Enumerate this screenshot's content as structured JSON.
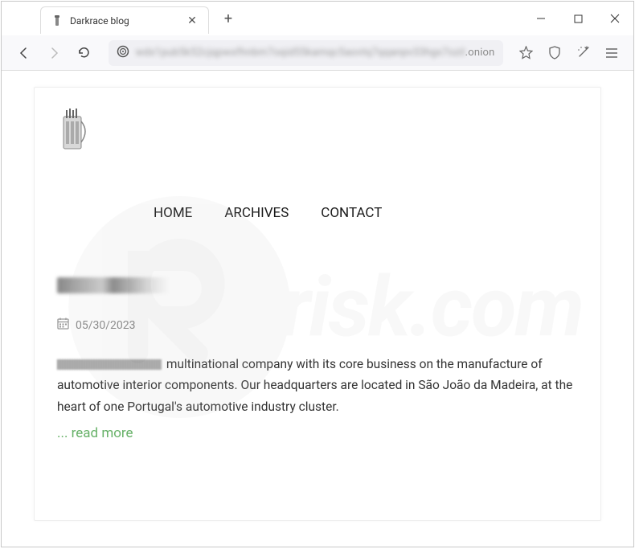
{
  "window": {
    "tab_title": "Darkrace blog"
  },
  "url_bar": {
    "suffix": ".onion"
  },
  "page": {
    "nav": {
      "home": "HOME",
      "archives": "ARCHIVES",
      "contact": "CONTACT"
    },
    "post": {
      "date": "05/30/2023",
      "body_text": " multinational company with its core business on the manufacture of automotive interior components. Our headquarters are located in São João da Madeira, at the heart of one Portugal's automotive industry cluster.",
      "read_more": "... read more"
    }
  },
  "watermark": {
    "text": "risk.com"
  }
}
